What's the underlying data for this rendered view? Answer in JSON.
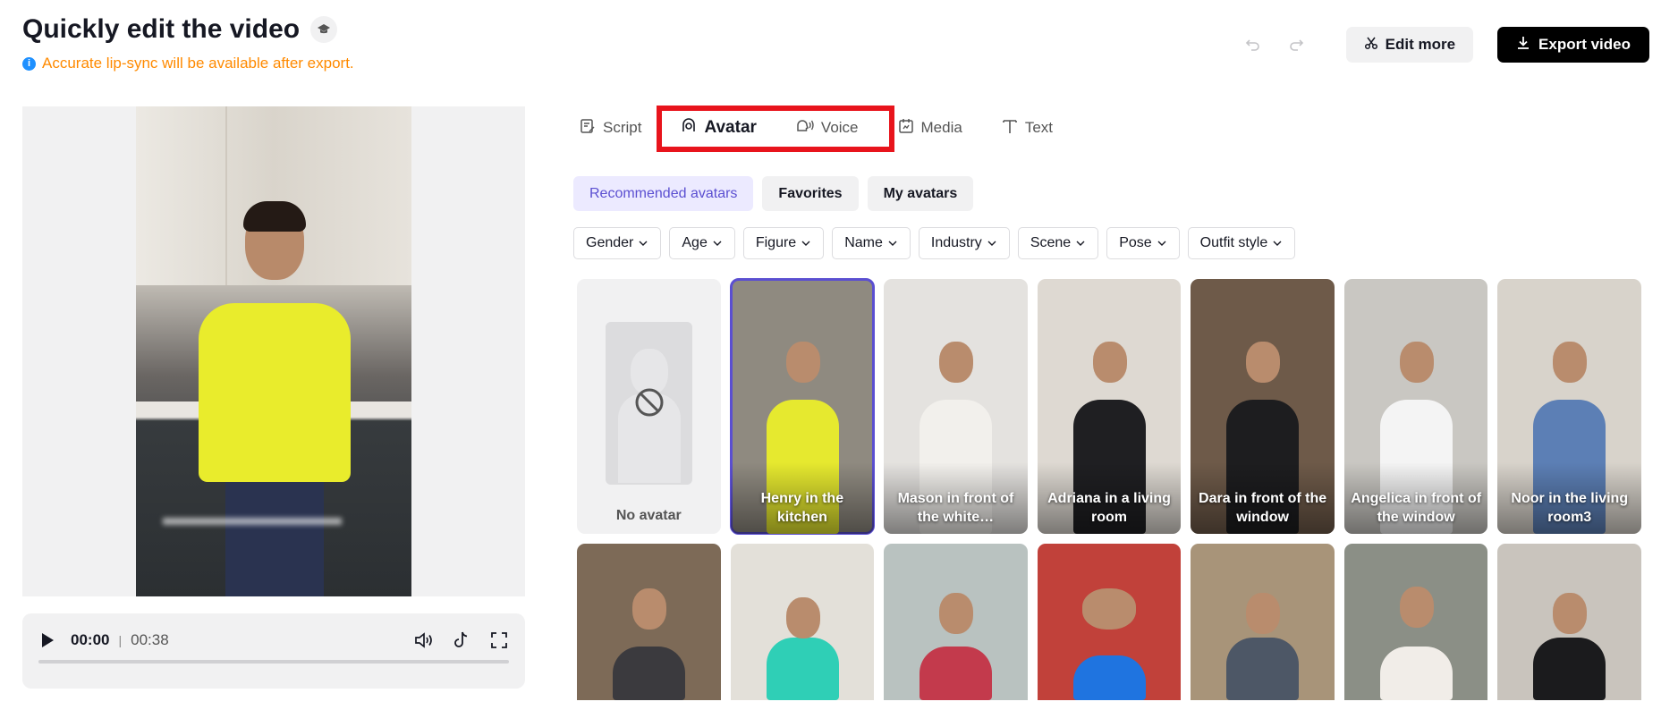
{
  "header": {
    "title": "Quickly edit the video",
    "notice": "Accurate lip-sync will be available after export.",
    "edit_more_label": "Edit more",
    "export_label": "Export video"
  },
  "player": {
    "current_time": "00:00",
    "duration": "00:38"
  },
  "tabs": [
    {
      "label": "Script",
      "icon": "script-icon"
    },
    {
      "label": "Avatar",
      "icon": "avatar-icon"
    },
    {
      "label": "Voice",
      "icon": "voice-icon"
    },
    {
      "label": "Media",
      "icon": "media-icon"
    },
    {
      "label": "Text",
      "icon": "text-icon"
    }
  ],
  "active_tab": "Avatar",
  "subtabs": [
    "Recommended avatars",
    "Favorites",
    "My avatars"
  ],
  "active_subtab": "Recommended avatars",
  "filters": [
    "Gender",
    "Age",
    "Figure",
    "Name",
    "Industry",
    "Scene",
    "Pose",
    "Outfit style"
  ],
  "avatars_row1": [
    {
      "label": "No avatar"
    },
    {
      "label": "Henry in the kitchen",
      "selected": true,
      "bg": "#8f8a80",
      "body": "#e6e92f"
    },
    {
      "label": "Mason in front of the white…",
      "bg": "#e4e2df",
      "body": "#f2f0ec"
    },
    {
      "label": "Adriana in a living room",
      "bg": "#ded9d2",
      "body": "#1f1f22"
    },
    {
      "label": "Dara in front of the window",
      "bg": "#6e5a49",
      "body": "#1d1d1f"
    },
    {
      "label": "Angelica in front of the window",
      "bg": "#c9c7c2",
      "body": "#f4f4f4"
    },
    {
      "label": "Noor in the living room3",
      "bg": "#d8d3cb",
      "body": "#5c7fb5"
    }
  ],
  "avatars_row2": [
    {
      "bg": "#7d6a57",
      "body": "#3b3a3e"
    },
    {
      "bg": "#e3e0d9",
      "body": "#2fcfb6"
    },
    {
      "bg": "#b9c2c0",
      "body": "#c33a4c"
    },
    {
      "bg": "#c1413a",
      "body": "#1f74e0"
    },
    {
      "bg": "#a89479",
      "body": "#4d5766"
    },
    {
      "bg": "#8b8f86",
      "body": "#f1ede8"
    },
    {
      "bg": "#c9c4bd",
      "body": "#1b1b1d"
    }
  ]
}
